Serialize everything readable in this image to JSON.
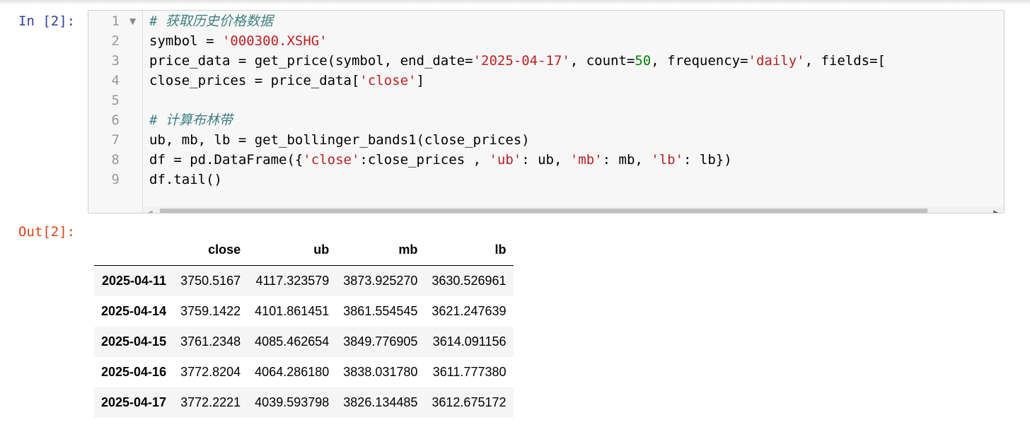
{
  "input_cell": {
    "prompt": "In [2]:",
    "line_numbers": [
      "1",
      "2",
      "3",
      "4",
      "5",
      "6",
      "7",
      "8",
      "9"
    ],
    "lines": [
      [
        {
          "t": "# 获取历史价格数据",
          "c": "cm-comment"
        }
      ],
      [
        {
          "t": "symbol = "
        },
        {
          "t": "'000300.XSHG'",
          "c": "cm-string"
        }
      ],
      [
        {
          "t": "price_data = get_price(symbol, end_date="
        },
        {
          "t": "'2025-04-17'",
          "c": "cm-string"
        },
        {
          "t": ", count="
        },
        {
          "t": "50",
          "c": "cm-number"
        },
        {
          "t": ", frequency="
        },
        {
          "t": "'daily'",
          "c": "cm-string"
        },
        {
          "t": ", fields=["
        }
      ],
      [
        {
          "t": "close_prices = price_data["
        },
        {
          "t": "'close'",
          "c": "cm-string"
        },
        {
          "t": "]"
        }
      ],
      [],
      [
        {
          "t": "# 计算布林带",
          "c": "cm-comment"
        }
      ],
      [
        {
          "t": "ub, mb, lb = get_bollinger_bands1(close_prices)"
        }
      ],
      [
        {
          "t": "df = pd.DataFrame({"
        },
        {
          "t": "'close'",
          "c": "cm-string"
        },
        {
          "t": ":close_prices , "
        },
        {
          "t": "'ub'",
          "c": "cm-string"
        },
        {
          "t": ": ub, "
        },
        {
          "t": "'mb'",
          "c": "cm-string"
        },
        {
          "t": ": mb, "
        },
        {
          "t": "'lb'",
          "c": "cm-string"
        },
        {
          "t": ": lb})"
        }
      ],
      [
        {
          "t": "df.tail()"
        }
      ]
    ]
  },
  "output_cell": {
    "prompt": "Out[2]:",
    "table": {
      "columns": [
        "",
        "close",
        "ub",
        "mb",
        "lb"
      ],
      "rows": [
        [
          "2025-04-11",
          "3750.5167",
          "4117.323579",
          "3873.925270",
          "3630.526961"
        ],
        [
          "2025-04-14",
          "3759.1422",
          "4101.861451",
          "3861.554545",
          "3621.247639"
        ],
        [
          "2025-04-15",
          "3761.2348",
          "4085.462654",
          "3849.776905",
          "3614.091156"
        ],
        [
          "2025-04-16",
          "3772.8204",
          "4064.286180",
          "3838.031780",
          "3611.777380"
        ],
        [
          "2025-04-17",
          "3772.2221",
          "4039.593798",
          "3826.134485",
          "3612.675172"
        ]
      ]
    }
  },
  "icons": {
    "fold": "fold-caret-down-icon",
    "scroll_left": "scroll-left-arrow-icon",
    "scroll_right": "scroll-right-arrow-icon"
  }
}
